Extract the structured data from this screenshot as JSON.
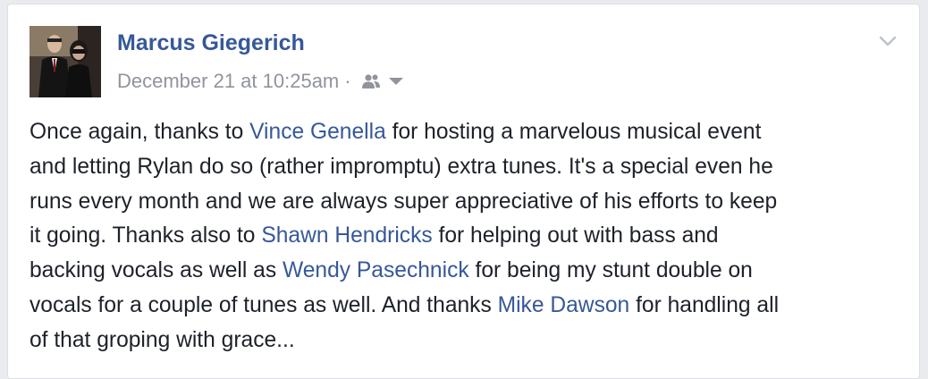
{
  "post": {
    "author": "Marcus Giegerich",
    "timestamp": "December 21 at 10:25am",
    "separator": "·",
    "audience_icon": "friends-icon",
    "menu_icon": "chevron-down-icon",
    "text_lines": [
      {
        "a": "Once again, thanks to ",
        "m": "Vince Genella",
        "b": " for hosting a marvelous musical event"
      },
      {
        "a": "and letting Rylan do so (rather impromptu) extra tunes. It's a special even he"
      },
      {
        "a": "runs every month and we are always super appreciative of his efforts to keep"
      },
      {
        "a": "it going. Thanks also to ",
        "m": "Shawn Hendricks",
        "b": " for helping out with bass and"
      },
      {
        "a": "backing vocals as well as ",
        "m": "Wendy Pasechnick",
        "b": " for being my stunt double on"
      },
      {
        "a": "vocals for a couple of tunes as well. And thanks ",
        "m": "Mike Dawson",
        "b": " for handling all"
      },
      {
        "a": "of that groping with grace..."
      }
    ]
  },
  "colors": {
    "link": "#365899",
    "text": "#1d2129",
    "meta": "#90949c",
    "background": "#e9ebee",
    "card": "#ffffff"
  }
}
